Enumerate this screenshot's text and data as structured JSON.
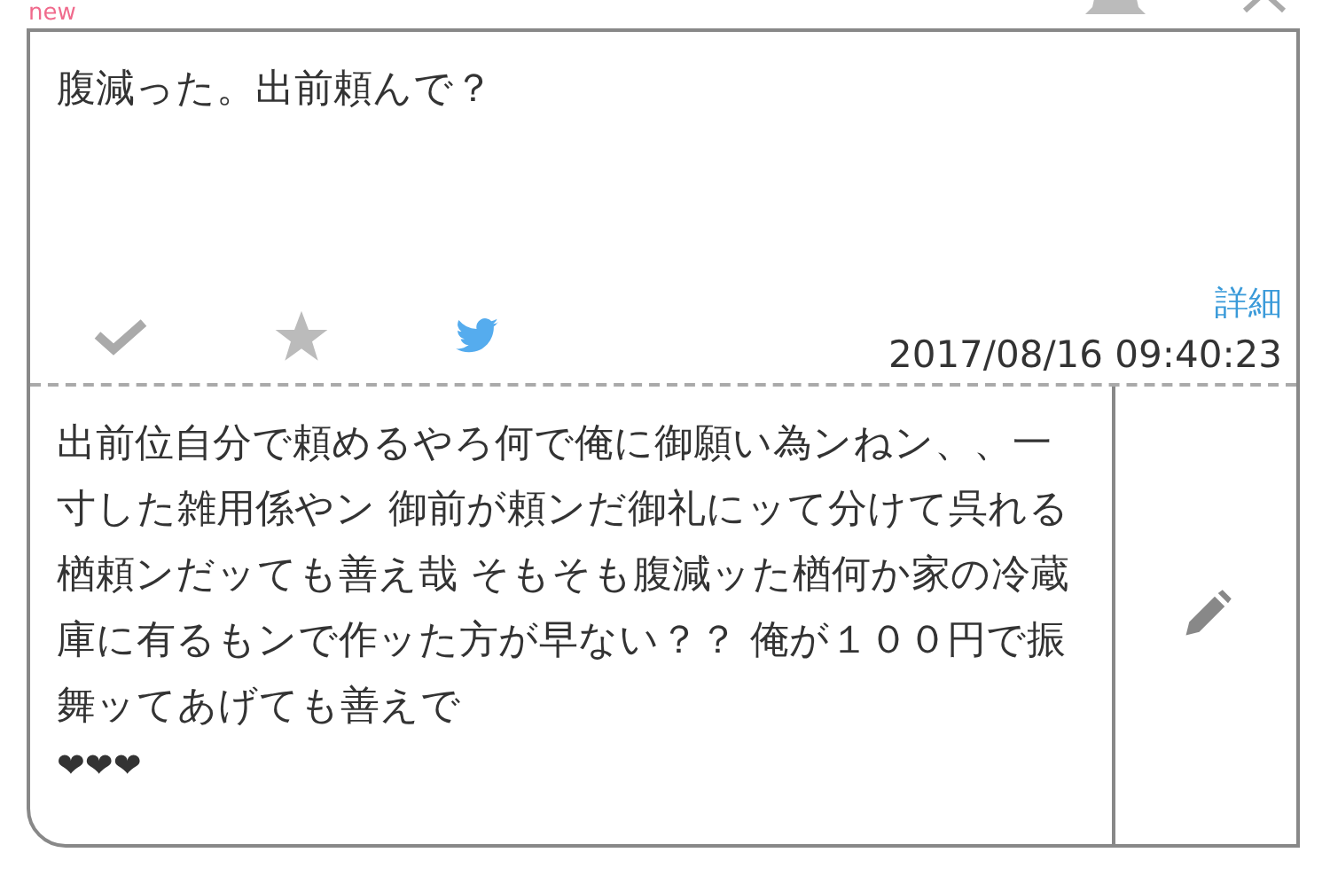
{
  "header": {
    "label": "new"
  },
  "question": {
    "text": "腹減った。出前頼んで？",
    "detail_link": "詳細",
    "timestamp": "2017/08/16 09:40:23"
  },
  "answer": {
    "text": "出前位自分で頼めるやろ何で俺に御願い為ンねン、、一寸した雑用係やン 御前が頼ンだ御礼にッて分けて呉れる楢頼ンだッても善え哉 そもそも腹減ッた楢何か家の冷蔵庫に有るもンで作ッた方が早ない？？ 俺が１００円で振舞ッてあげても善えで",
    "hearts": "❤❤❤"
  }
}
